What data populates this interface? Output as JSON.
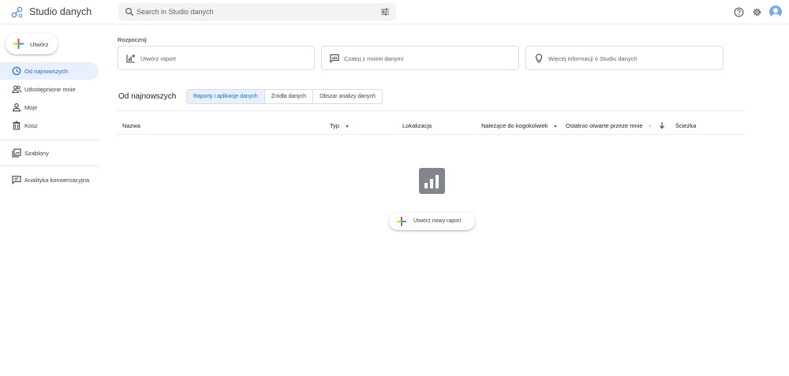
{
  "header": {
    "app_title": "Studio danych",
    "search_placeholder": "Search in Studio danych",
    "icons": [
      "logo-icon",
      "search-icon",
      "tune-icon",
      "help-icon",
      "gear-icon",
      "avatar"
    ]
  },
  "sidebar": {
    "create_label": "Utwórz",
    "items": [
      {
        "label": "Od najnowszych",
        "icon": "clock-icon",
        "active": true
      },
      {
        "label": "Udostępnione mnie",
        "icon": "people-icon"
      },
      {
        "label": "Moje",
        "icon": "person-icon"
      },
      {
        "label": "Kosz",
        "icon": "trash-icon"
      },
      {
        "label": "Szablony",
        "icon": "templates-icon"
      },
      {
        "label": "Analityka konwersacyjna",
        "icon": "chat-analytics-icon"
      }
    ]
  },
  "start": {
    "title": "Rozpocznij",
    "cards": [
      {
        "label": "Utwórz raport",
        "icon": "add-chart-icon"
      },
      {
        "label": "Czatuj z moimi danymi",
        "icon": "chat-data-icon"
      },
      {
        "label": "Więcej informacji o Studiu danych",
        "icon": "lightbulb-icon"
      }
    ]
  },
  "recent": {
    "title": "Od najnowszych",
    "tabs": [
      {
        "label": "Raporty i aplikacje danych",
        "active": true
      },
      {
        "label": "Źródła danych"
      },
      {
        "label": "Obszar analizy danych"
      }
    ]
  },
  "table": {
    "columns": [
      "Nazwa",
      "Typ",
      "Lokalizacja",
      "Należące do kogokolwiek",
      "Ostatnio otwarte przeze mnie",
      "Ścieżka"
    ]
  },
  "empty_state": {
    "button_label": "Utwórz nowy raport"
  },
  "colors": {
    "accent": "#1967d2",
    "active_bg": "#e8f0fe",
    "icon_grey": "#80868b"
  }
}
